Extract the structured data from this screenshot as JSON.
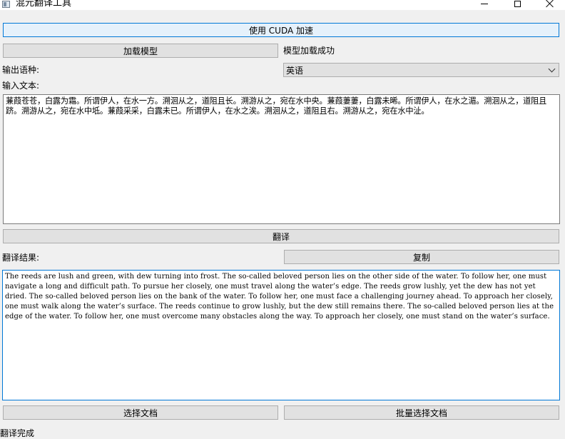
{
  "window": {
    "title": "混元翻译工具"
  },
  "controls": {
    "cuda_button": "使用 CUDA 加速",
    "load_model_button": "加载模型",
    "model_status": "模型加载成功",
    "output_language_label": "输出语种:",
    "output_language_value": "英语",
    "input_text_label": "输入文本:",
    "translate_button": "翻译",
    "result_label": "翻译结果:",
    "copy_button": "复制",
    "select_file_button": "选择文档",
    "batch_select_button": "批量选择文档"
  },
  "input_text": "蒹葭苍苍，白露为霜。所谓伊人，在水一方。溯洄从之，道阻且长。溯游从之，宛在水中央。蒹葭萋萋，白露未晞。所谓伊人，在水之湄。溯洄从之，道阻且跻。溯游从之，宛在水中坻。蒹葭采采，白露未已。所谓伊人，在水之涘。溯洄从之，道阻且右。溯游从之，宛在水中沚。",
  "output_text": "The reeds are lush and green, with dew turning into frost. The so-called beloved person lies on the other side of the water. To follow her, one must navigate a long and difficult path. To pursue her closely, one must travel along the water’s edge. The reeds grow lushly, yet the dew has not yet dried. The so-called beloved person lies on the bank of the water. To follow her, one must face a challenging journey ahead. To approach her closely, one must walk along the water’s surface. The reeds continue to grow lushly, but the dew still remains there. The so-called beloved person lies at the edge of the water. To follow her, one must overcome many obstacles along the way. To approach her closely, one must stand on the water’s surface.",
  "status_bar": {
    "text": "翻译完成"
  },
  "colors": {
    "window_bg": "#f0f0f0",
    "button_bg": "#e1e1e1",
    "focus_blue": "#0078d7",
    "primary_button_bg": "#e5f1fb"
  },
  "icons": {
    "app": "app-window-icon",
    "minimize": "minimize-icon",
    "maximize": "maximize-icon",
    "close": "close-icon",
    "dropdown": "chevron-down-icon"
  }
}
